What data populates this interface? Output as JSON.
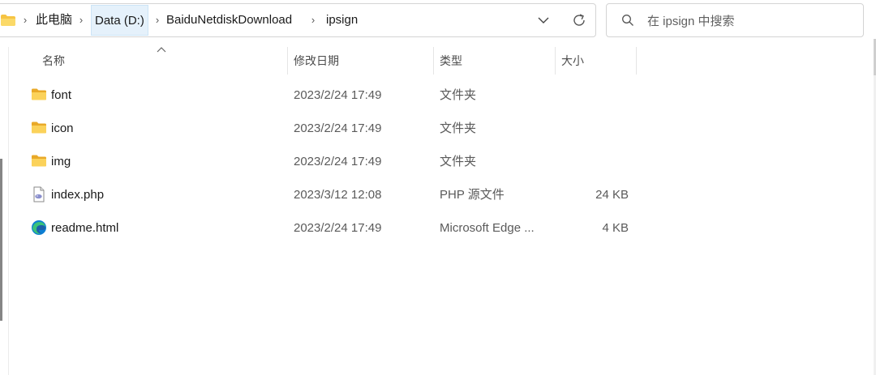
{
  "address_bar": {
    "crumbs": [
      "此电脑",
      "Data (D:)",
      "BaiduNetdiskDownload",
      "ipsign"
    ]
  },
  "search": {
    "placeholder": "在 ipsign 中搜索"
  },
  "columns": {
    "name": "名称",
    "modified": "修改日期",
    "type": "类型",
    "size": "大小"
  },
  "files": [
    {
      "name": "font",
      "modified": "2023/2/24 17:49",
      "type": "文件夹",
      "size": "",
      "icon": "folder-icon"
    },
    {
      "name": "icon",
      "modified": "2023/2/24 17:49",
      "type": "文件夹",
      "size": "",
      "icon": "folder-icon"
    },
    {
      "name": "img",
      "modified": "2023/2/24 17:49",
      "type": "文件夹",
      "size": "",
      "icon": "folder-icon"
    },
    {
      "name": "index.php",
      "modified": "2023/3/12 12:08",
      "type": "PHP 源文件",
      "size": "24 KB",
      "icon": "php-file-icon"
    },
    {
      "name": "readme.html",
      "modified": "2023/2/24 17:49",
      "type": "Microsoft Edge ...",
      "size": "4 KB",
      "icon": "edge-icon"
    }
  ],
  "colors": {
    "folder": "#f6c443",
    "active_crumb_bg": "#e5f1fb",
    "edge_blue": "#0c7fd4",
    "edge_green": "#3ac27a"
  }
}
